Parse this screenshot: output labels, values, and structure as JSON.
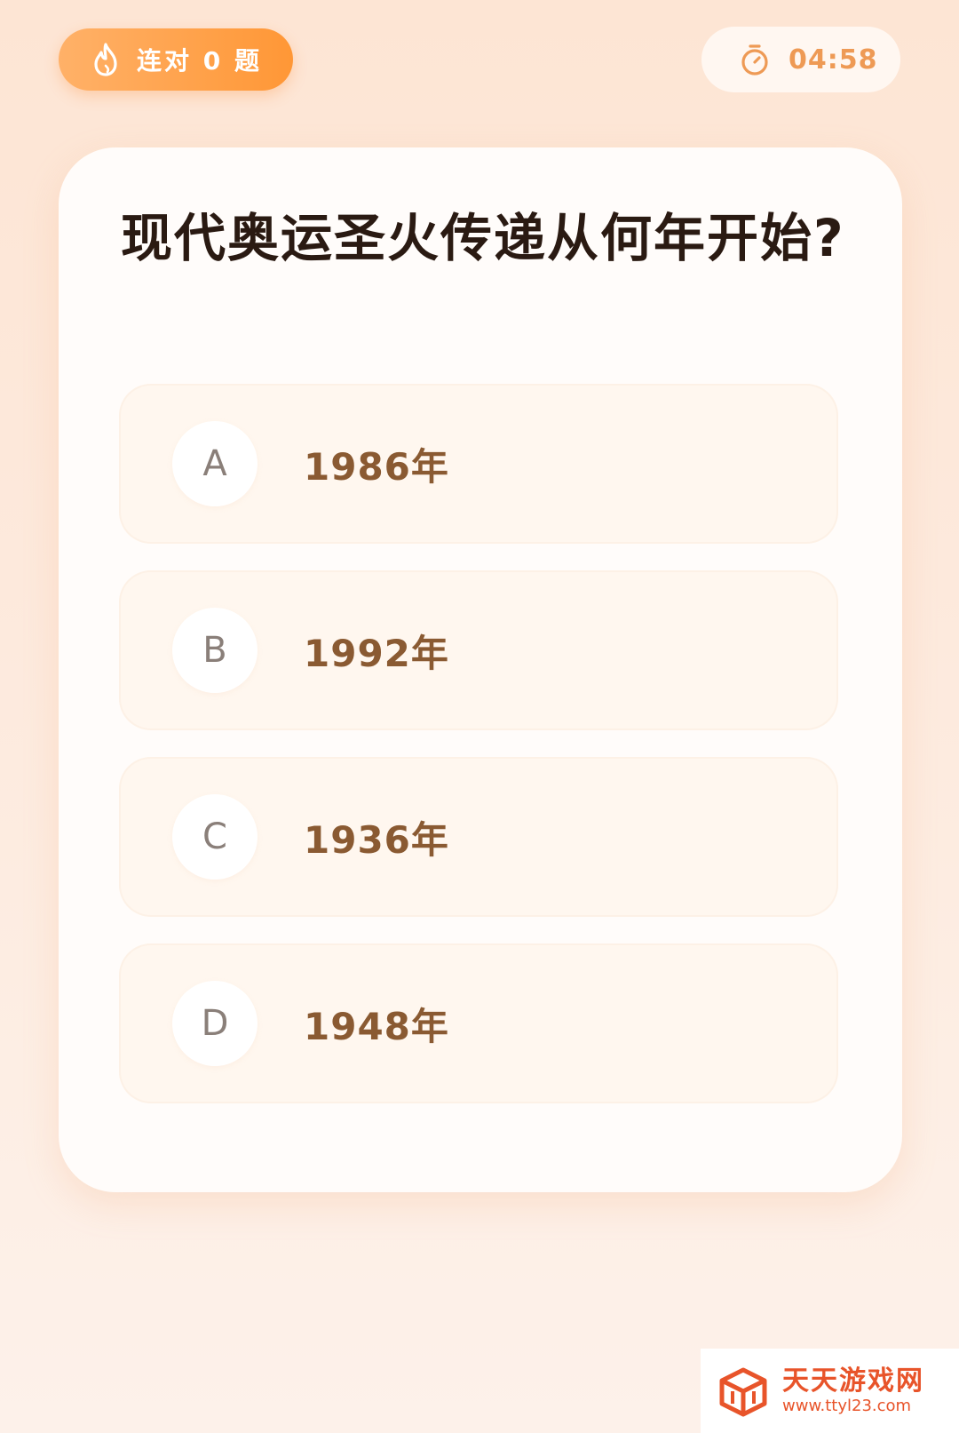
{
  "header": {
    "streak_label": "连对 0 题",
    "timer": "04:58",
    "streak_icon": "flame-icon",
    "timer_icon": "stopwatch-icon",
    "accent_color": "#ff9a3c"
  },
  "quiz": {
    "question": "现代奥运圣火传递从何年开始?",
    "options": [
      {
        "letter": "A",
        "text": "1986年"
      },
      {
        "letter": "B",
        "text": "1992年"
      },
      {
        "letter": "C",
        "text": "1936年"
      },
      {
        "letter": "D",
        "text": "1948年"
      }
    ]
  },
  "watermark": {
    "name": "天天游戏网",
    "url": "www.ttyl23.com"
  }
}
